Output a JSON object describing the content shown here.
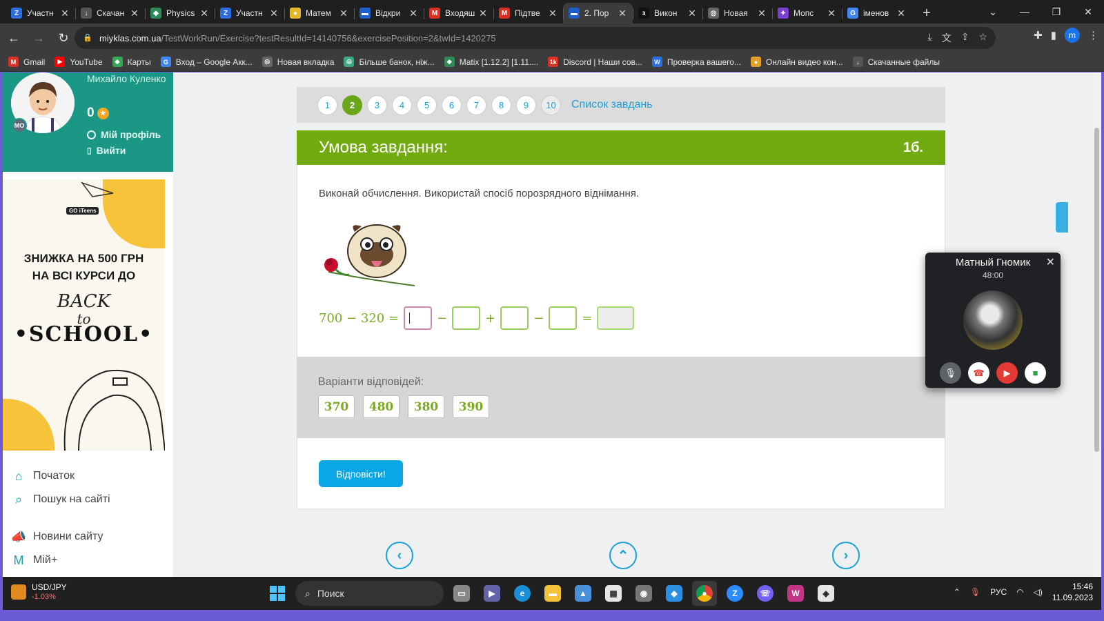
{
  "browser": {
    "tabs": [
      {
        "label": "Участн",
        "color": "#2d6cdf",
        "glyph": "Z"
      },
      {
        "label": "Скачан",
        "color": "#555555",
        "glyph": "↓"
      },
      {
        "label": "Physics",
        "color": "#2e8b57",
        "glyph": "◆"
      },
      {
        "label": "Участн",
        "color": "#2d6cdf",
        "glyph": "Z"
      },
      {
        "label": "Матем",
        "color": "#e0b92b",
        "glyph": "●"
      },
      {
        "label": "Відкри",
        "color": "#1d5fc9",
        "glyph": "▬"
      },
      {
        "label": "Входяш",
        "color": "#d93025",
        "glyph": "M"
      },
      {
        "label": "Підтве",
        "color": "#d93025",
        "glyph": "M"
      },
      {
        "label": "2. Пор",
        "color": "#1d5fc9",
        "glyph": "▬"
      },
      {
        "label": "Викон",
        "color": "#111111",
        "glyph": "з"
      },
      {
        "label": "Новая",
        "color": "#666666",
        "glyph": "◎"
      },
      {
        "label": "Мопс",
        "color": "#7b3fd1",
        "glyph": "✦"
      },
      {
        "label": "іменов",
        "color": "#4285f4",
        "glyph": "G"
      }
    ],
    "active_tab_index": 8,
    "url_host": "miyklas.com.ua",
    "url_path": "/TestWorkRun/Exercise?testResultId=14140756&exercisePosition=2&twId=1420275",
    "profile_initial": "m",
    "bookmarks": [
      {
        "label": "Gmail",
        "color": "#d93025",
        "glyph": "M"
      },
      {
        "label": "YouTube",
        "color": "#ff0000",
        "glyph": "▶"
      },
      {
        "label": "Карты",
        "color": "#34a853",
        "glyph": "◆"
      },
      {
        "label": "Вход – Google Акк...",
        "color": "#4285f4",
        "glyph": "G"
      },
      {
        "label": "Новая вкладка",
        "color": "#666666",
        "glyph": "◎"
      },
      {
        "label": "Більше банок, ніж...",
        "color": "#3aa886",
        "glyph": "◎"
      },
      {
        "label": "Matix [1.12.2] [1.11....",
        "color": "#2e8b57",
        "glyph": "◆"
      },
      {
        "label": "Discord | Наши сов...",
        "color": "#d93025",
        "glyph": "1k"
      },
      {
        "label": "Проверка вашего...",
        "color": "#2b6cdf",
        "glyph": "W"
      },
      {
        "label": "Онлайн видео кон...",
        "color": "#e2a02b",
        "glyph": "●"
      },
      {
        "label": "Скачанные файлы",
        "color": "#555555",
        "glyph": "↓"
      }
    ]
  },
  "profile": {
    "name": "Михайло Куленко",
    "score": "0",
    "badge": "МО",
    "my_profile": "Мій профіль",
    "logout": "Вийти"
  },
  "ad": {
    "logo": "GO iTeens",
    "line1": "ЗНИЖКА НА 500 ГРН",
    "line2": "НА ВСІ КУРСИ ДО",
    "back": "BACK",
    "to": "to",
    "school": "•SCHOOL•"
  },
  "sidenav": [
    {
      "label": "Початок",
      "icon": "⌂"
    },
    {
      "label": "Пошук на сайті",
      "icon": "⌕"
    },
    {
      "label": "Новини сайту",
      "icon": "📣"
    },
    {
      "label": "Мій+",
      "icon": "М"
    }
  ],
  "pager": {
    "pages": [
      "1",
      "2",
      "3",
      "4",
      "5",
      "6",
      "7",
      "8",
      "9",
      "10"
    ],
    "current": 2,
    "tasks_link": "Список завдань"
  },
  "task": {
    "header": "Умова завдання:",
    "points": "1б.",
    "instruction": "Виконай обчислення. Використай спосіб порозрядного віднімання.",
    "equation_left": "700 − 320 =",
    "op1": "−",
    "op2": "+",
    "op3": "−",
    "eq": "="
  },
  "answers": {
    "label": "Варіанти відповідей:",
    "options": [
      "370",
      "480",
      "380",
      "390"
    ]
  },
  "submit_label": "Відповісти!",
  "call": {
    "name": "Матный Гномик",
    "time": "48:00"
  },
  "taskbar": {
    "ticker_symbol": "USD/JPY",
    "ticker_change": "-1.03%",
    "search_placeholder": "Поиск",
    "lang": "РУС",
    "time": "15:46",
    "date": "11.09.2023"
  }
}
